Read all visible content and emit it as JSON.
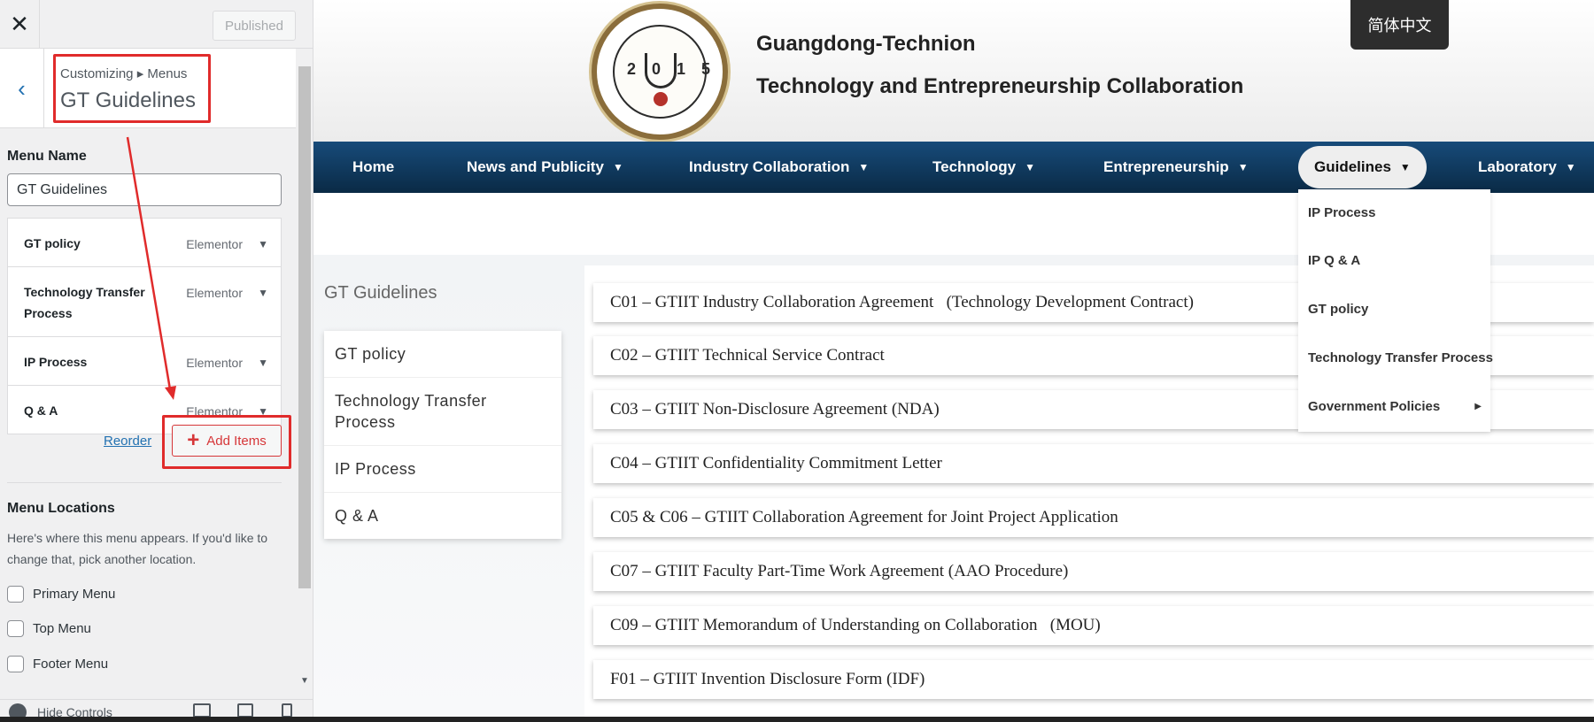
{
  "sidebar": {
    "close_icon": "close-icon",
    "published_label": "Published",
    "breadcrumb": "Customizing ▸ Menus",
    "title": "GT Guidelines",
    "menu_name_label": "Menu Name",
    "menu_name_value": "GT Guidelines",
    "items": [
      {
        "label": "GT policy",
        "type": "Elementor"
      },
      {
        "label": "Technology Transfer Process",
        "type": "Elementor"
      },
      {
        "label": "IP Process",
        "type": "Elementor"
      },
      {
        "label": "Q & A",
        "type": "Elementor"
      }
    ],
    "reorder_label": "Reorder",
    "add_items_label": "Add Items",
    "locations_heading": "Menu Locations",
    "locations_text": "Here's where this menu appears. If you'd like to change that, pick another location.",
    "locations": [
      "Primary Menu",
      "Top Menu",
      "Footer Menu"
    ],
    "hide_controls_label": "Hide Controls"
  },
  "site": {
    "logo_number": "2015",
    "title": "Guangdong-Technion",
    "subtitle": "Technology and Entrepreneurship Collaboration",
    "language_button": "简体中文",
    "nav": [
      {
        "label": "Home"
      },
      {
        "label": "News and Publicity"
      },
      {
        "label": "Industry Collaboration"
      },
      {
        "label": "Technology"
      },
      {
        "label": "Entrepreneurship"
      },
      {
        "label": "Guidelines"
      },
      {
        "label": "Laboratory"
      }
    ],
    "dropdown": [
      {
        "label": "IP Process"
      },
      {
        "label": "IP Q & A"
      },
      {
        "label": "GT policy"
      },
      {
        "label": "Technology Transfer Process"
      },
      {
        "label": "Government Policies"
      }
    ],
    "subnav_title": "GT Guidelines",
    "subnav": [
      "GT policy",
      "Technology Transfer Process",
      "IP Process",
      "Q & A"
    ],
    "documents": [
      "C01 – GTIIT Industry Collaboration Agreement   (Technology Development Contract)",
      "C02 – GTIIT Technical Service Contract",
      "C03 – GTIIT Non-Disclosure Agreement (NDA)",
      "C04 – GTIIT Confidentiality Commitment Letter",
      "C05 & C06 – GTIIT Collaboration Agreement for Joint Project Application",
      "C07 – GTIIT Faculty Part-Time Work Agreement (AAO Procedure)",
      "C09 – GTIIT Memorandum of Understanding on Collaboration   (MOU)",
      "F01 – GTIIT Invention Disclosure Form (IDF)"
    ]
  },
  "colors": {
    "annotation_red": "#e02b2b",
    "nav_blue": "#174b7a",
    "link_blue": "#2271b1"
  }
}
